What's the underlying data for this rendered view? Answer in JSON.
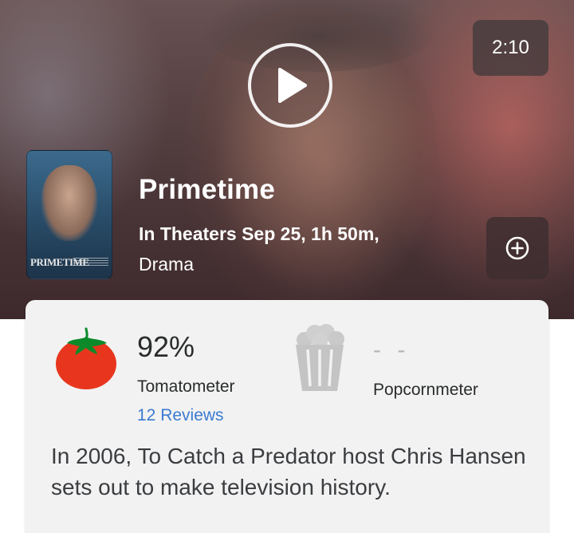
{
  "trailer": {
    "duration": "2:10"
  },
  "movie": {
    "poster_title": "PRIMETIME",
    "title": "Primetime",
    "release_line": "In Theaters Sep 25, 1h 50m,",
    "genre": "Drama"
  },
  "scores": {
    "tomatometer_value": "92%",
    "tomatometer_label": "Tomatometer",
    "reviews_link": "12 Reviews",
    "popcornmeter_value": "- -",
    "popcornmeter_label": "Popcornmeter"
  },
  "synopsis": "In 2006, To Catch a Predator host Chris Hansen sets out to make television history.",
  "icons": {
    "play": "play-icon",
    "add": "plus-circle-icon",
    "tomato": "tomato-icon",
    "popcorn": "popcorn-bucket-icon"
  },
  "colors": {
    "tomato_red": "#e8361e",
    "link_blue": "#3b7bd0",
    "card_bg": "#f2f2f2"
  }
}
